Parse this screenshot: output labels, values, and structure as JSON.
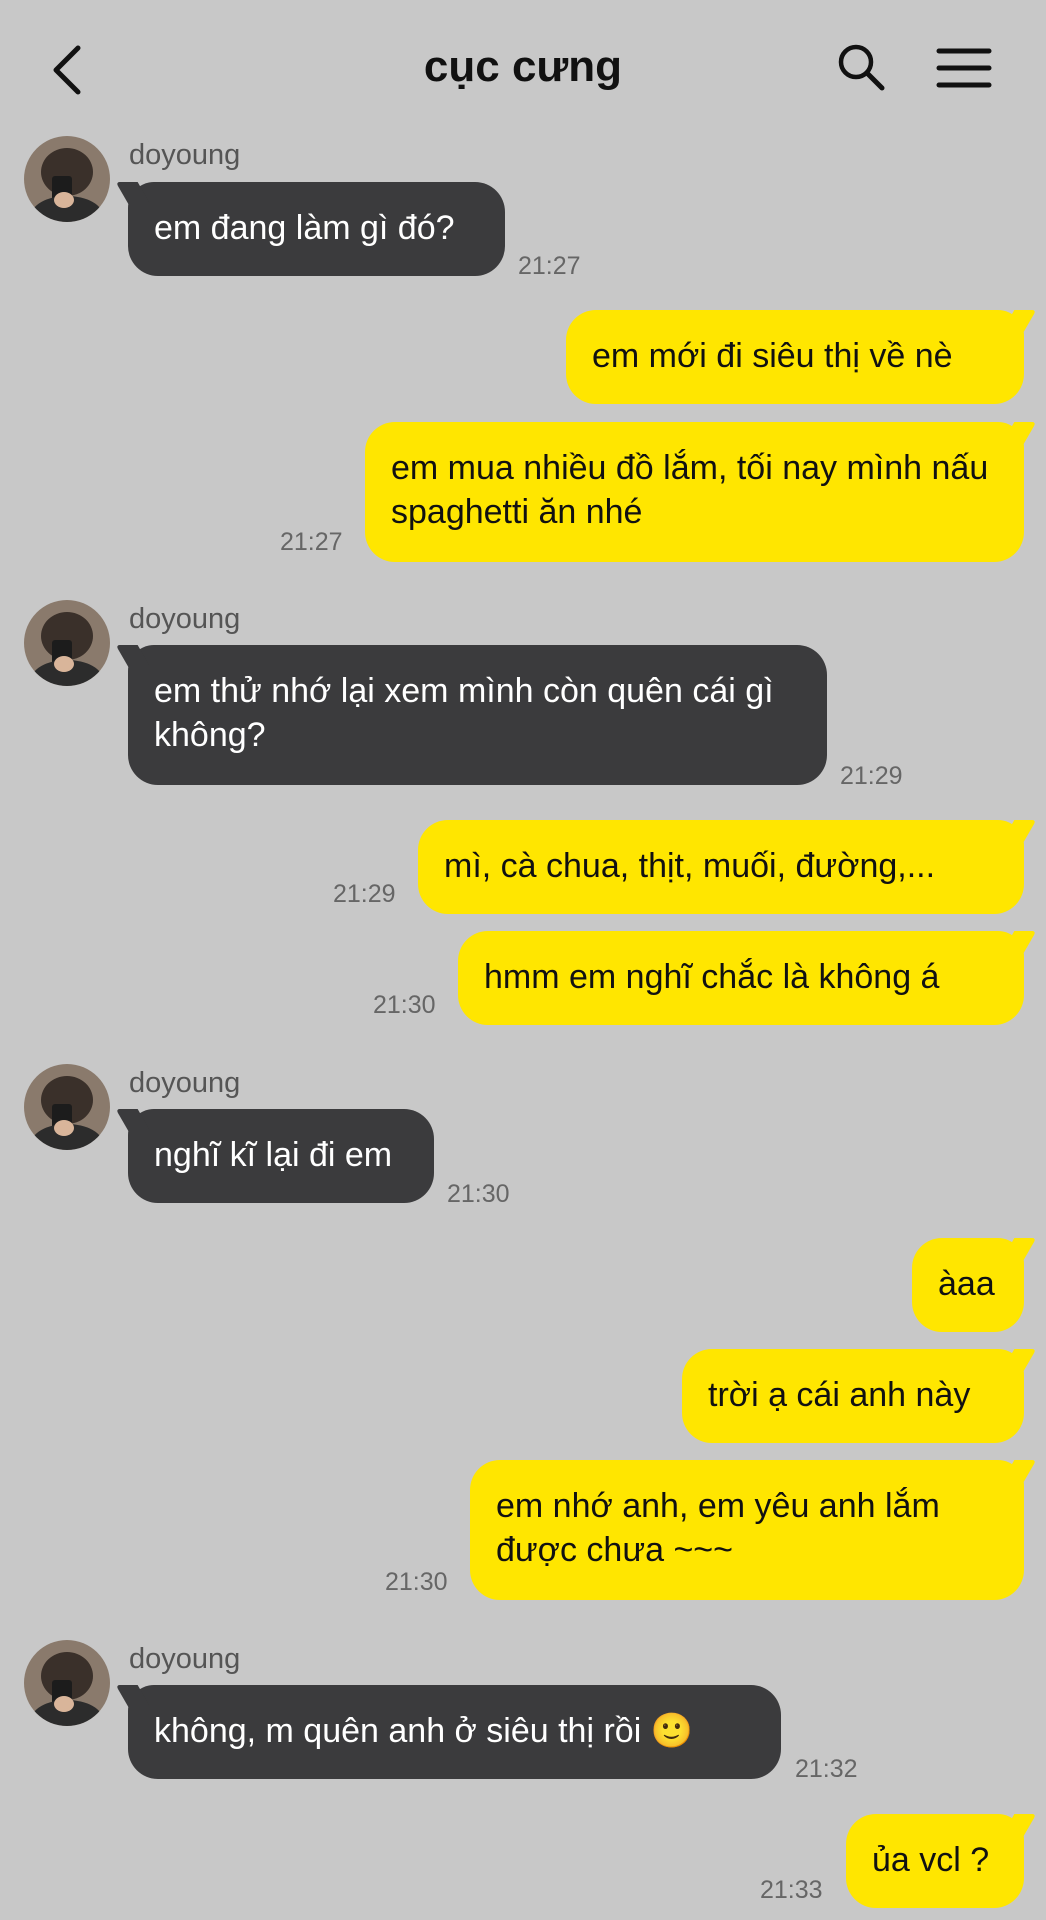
{
  "header": {
    "title": "cục cưng",
    "back_icon": "chevron-left-icon",
    "search_icon": "search-icon",
    "menu_icon": "hamburger-menu-icon"
  },
  "colors": {
    "background": "#c8c8c8",
    "incoming_bubble": "#3b3b3d",
    "outgoing_bubble": "#ffe600"
  },
  "messages": [
    {
      "sender": "doyoung",
      "text": "em đang làm gì đó?",
      "time": "21:27"
    },
    {
      "text": "em mới đi siêu thị về nè"
    },
    {
      "text": "em mua nhiều đồ lắm, tối nay mình nấu spaghetti ăn nhé",
      "time": "21:27"
    },
    {
      "sender": "doyoung",
      "text": "em thử nhớ lại xem mình còn quên cái gì không?",
      "time": "21:29"
    },
    {
      "text": "mì, cà chua, thịt, muối, đường,...",
      "time": "21:29"
    },
    {
      "text": "hmm em nghĩ chắc là không á",
      "time": "21:30"
    },
    {
      "sender": "doyoung",
      "text": "nghĩ kĩ lại đi em",
      "time": "21:30"
    },
    {
      "text": "àaa"
    },
    {
      "text": "trời ạ cái anh này"
    },
    {
      "text": "em nhớ anh, em yêu anh lắm được chưa ~~~",
      "time": "21:30"
    },
    {
      "sender": "doyoung",
      "text": "không, m quên anh ở siêu thị rồi 🙂",
      "time": "21:32"
    },
    {
      "text": "ủa vcl ?",
      "time": "21:33"
    }
  ]
}
